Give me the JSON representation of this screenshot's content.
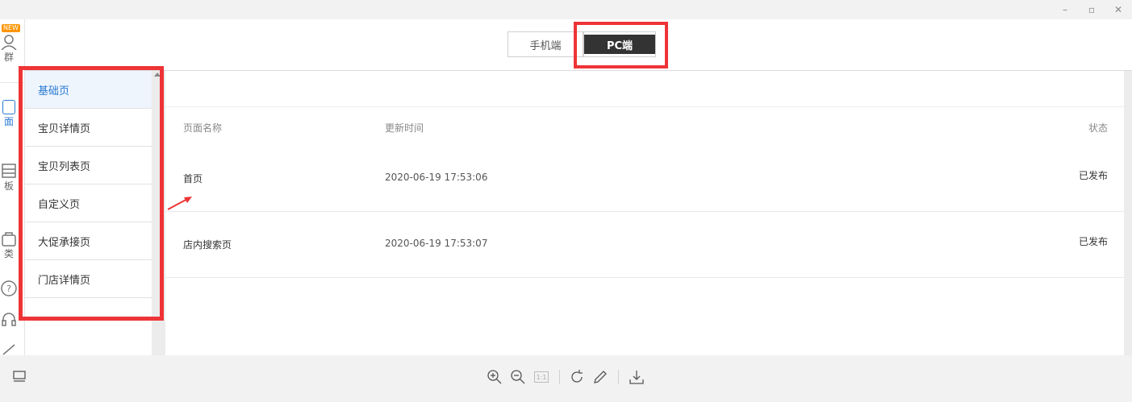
{
  "window": {
    "minimize_glyph": "–",
    "maximize_glyph": "▫",
    "close_glyph": "✕"
  },
  "left_rail": {
    "new_badge": "NEW",
    "items": [
      {
        "label": "群",
        "icon": "user-icon"
      },
      {
        "label": "面",
        "icon": "page-icon",
        "active": true
      },
      {
        "label": "板",
        "icon": "template-icon"
      },
      {
        "label": "类",
        "icon": "category-icon"
      },
      {
        "label": "",
        "icon": "help-icon"
      },
      {
        "label": "",
        "icon": "headset-icon"
      },
      {
        "label": "",
        "icon": "edit-icon"
      }
    ]
  },
  "device_switch": {
    "mobile_label": "手机端",
    "pc_label": "PC端",
    "selected": "PC端"
  },
  "sidebar": {
    "items": [
      {
        "label": "基础页",
        "active": true
      },
      {
        "label": "宝贝详情页"
      },
      {
        "label": "宝贝列表页"
      },
      {
        "label": "自定义页"
      },
      {
        "label": "大促承接页"
      },
      {
        "label": "门店详情页"
      }
    ]
  },
  "table": {
    "headers": {
      "name": "页面名称",
      "time": "更新时间",
      "status": "状态"
    },
    "rows": [
      {
        "name": "首页",
        "time": "2020-06-19 17:53:06",
        "status": "已发布"
      },
      {
        "name": "店内搜索页",
        "time": "2020-06-19 17:53:07",
        "status": "已发布"
      }
    ]
  },
  "toolbar": {
    "actual_size_label": "1:1",
    "icons": [
      "layout-icon",
      "zoom-in-icon",
      "zoom-out-icon",
      "actual-size-icon",
      "rotate-icon",
      "pen-icon",
      "download-icon"
    ]
  },
  "colors": {
    "highlight": "#ee3436",
    "accent": "#2a7ad2",
    "pc_button_bg": "#333333"
  }
}
